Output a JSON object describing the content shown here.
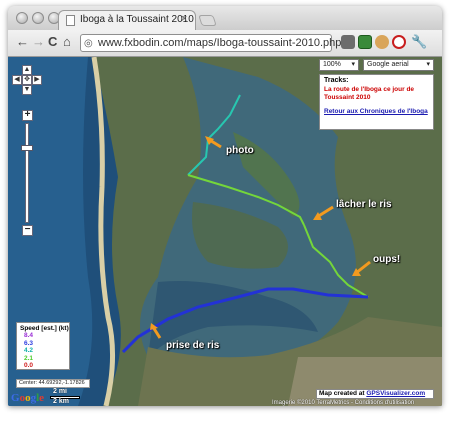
{
  "browser": {
    "tab_title": "Iboga à la Toussaint 2010",
    "tab_close": "×",
    "back": "←",
    "forward": "→",
    "reload": "C",
    "home": "⌂",
    "url": "www.fxbodin.com/maps/Iboga-toussaint-2010.php"
  },
  "map": {
    "zoom_select": "100%",
    "maptype_select": "Google aerial",
    "tracks": {
      "heading": "Tracks:",
      "item": "La route de l'Iboga ce jour de Toussaint 2010",
      "link": "Retour aux Chroniques de l'Iboga"
    },
    "labels": {
      "photo": "photo",
      "lacher": "lâcher le ris",
      "oups": "oups!",
      "prise": "prise de ris"
    },
    "legend": {
      "title": "Speed [est.] (kt)",
      "values": [
        "8.4",
        "6.3",
        "4.2",
        "2.1",
        "0.0"
      ]
    },
    "center": "Center: 44.69292,-1.17826",
    "scale_mi": "2 mi",
    "scale_km": "2 km",
    "google": "Google",
    "credit_prefix": "Map created at",
    "credit_link": "GPSVisualizer.com",
    "copyright": "Imagerie ©2010 TerraMetrics - Conditions d'utilisation"
  },
  "colors": {
    "ocean": "#1f4f7a",
    "land": "#5b6d4a",
    "bay": "#40697a",
    "track_fast": "#2332d6",
    "track_mid": "#27c7b0",
    "track_slow": "#74d63a",
    "legend": [
      "#9b2fd6",
      "#2b3be0",
      "#12b0a8",
      "#4dcc2a",
      "#d01a1a"
    ],
    "arrow": "#f39a1f"
  }
}
